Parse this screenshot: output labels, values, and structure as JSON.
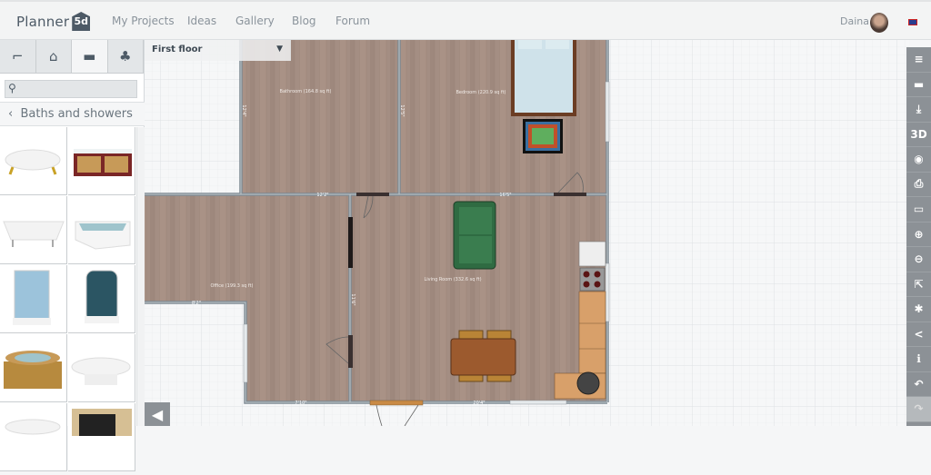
{
  "header": {
    "logo": "Planner 5d",
    "logo_text": "Planner",
    "logo_badge": "5d",
    "nav": [
      "My Projects",
      "Ideas",
      "Gallery",
      "Blog",
      "Forum"
    ],
    "user": "Daina",
    "language": "uk-flag-icon"
  },
  "left_panel": {
    "tabs": [
      {
        "icon": "floor-plan-icon",
        "glyph": "⌐"
      },
      {
        "icon": "house-icon",
        "glyph": "⌂"
      },
      {
        "icon": "sofa-icon",
        "glyph": "▬"
      },
      {
        "icon": "tree-icon",
        "glyph": "♣"
      }
    ],
    "search": {
      "placeholder": "",
      "value": ""
    },
    "category": "Baths and showers",
    "back_glyph": "‹",
    "items": [
      "clawfoot-bathtub",
      "paneled-bathtub",
      "freestanding-bathtub",
      "corner-bathtub",
      "square-shower-cabin",
      "rounded-shower-cabin",
      "wooden-hot-tub",
      "pedestal-bathtub",
      "bathtub",
      "shower-cabin"
    ]
  },
  "floor_select": {
    "value": "First floor"
  },
  "plan": {
    "rooms": [
      "Bathroom (164.8 sq ft)",
      "Bedroom (220.9 sq ft)",
      "Office (199.3 sq ft)",
      "Living Room (332.6 sq ft)"
    ],
    "walls": [
      "12'2\"",
      "16'5\"",
      "8'2\"",
      "7'10\"",
      "20'4\"",
      "12'4\"",
      "12'5\"",
      "11'6\""
    ]
  },
  "toolbar": [
    {
      "name": "menu-icon",
      "glyph": "≡"
    },
    {
      "name": "folder-icon",
      "glyph": "▬"
    },
    {
      "name": "download-icon",
      "glyph": "⤓"
    },
    {
      "name": "3d-view-button",
      "glyph": "3D"
    },
    {
      "name": "camera-icon",
      "glyph": "◉"
    },
    {
      "name": "print-icon",
      "glyph": "⎙"
    },
    {
      "name": "ruler-icon",
      "glyph": "▭"
    },
    {
      "name": "zoom-in-icon",
      "glyph": "⊕"
    },
    {
      "name": "zoom-out-icon",
      "glyph": "⊖"
    },
    {
      "name": "fullscreen-icon",
      "glyph": "⇱"
    },
    {
      "name": "settings-icon",
      "glyph": "✱"
    },
    {
      "name": "share-icon",
      "glyph": "<"
    },
    {
      "name": "info-icon",
      "glyph": "ℹ"
    },
    {
      "name": "undo-icon",
      "glyph": "↶"
    },
    {
      "name": "redo-icon",
      "glyph": "↷"
    }
  ],
  "canvas_back": "◀"
}
